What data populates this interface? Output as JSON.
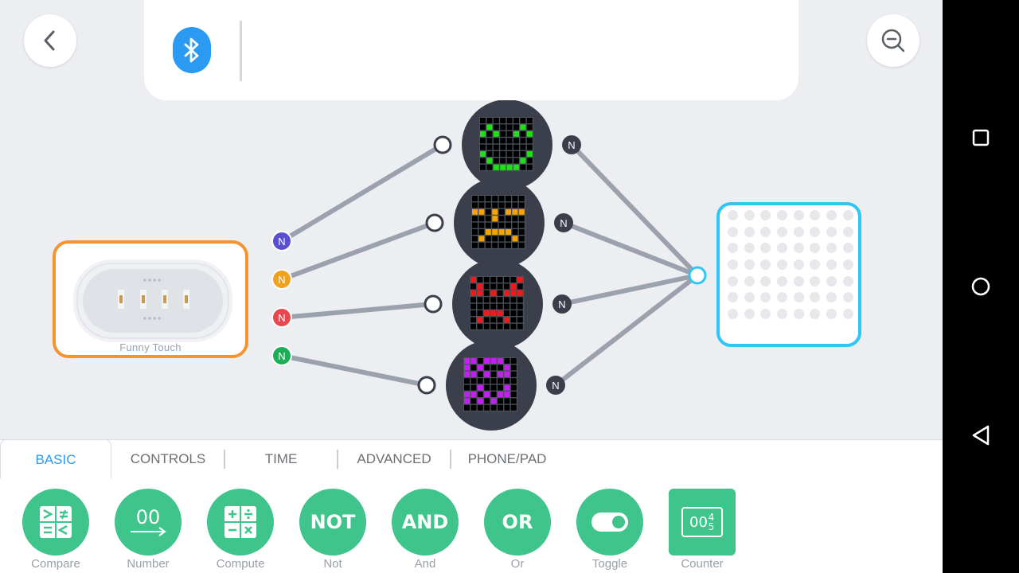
{
  "device": {
    "label": "Funny Touch"
  },
  "tabs": [
    {
      "label": "BASIC",
      "active": true
    },
    {
      "label": "CONTROLS",
      "active": false
    },
    {
      "label": "TIME",
      "active": false
    },
    {
      "label": "ADVANCED",
      "active": false
    },
    {
      "label": "PHONE/PAD",
      "active": false
    }
  ],
  "blocks": [
    {
      "label": "Compare",
      "icon": "compare-icon"
    },
    {
      "label": "Number",
      "icon": "number-icon",
      "glyph": "00"
    },
    {
      "label": "Compute",
      "icon": "compute-icon"
    },
    {
      "label": "Not",
      "icon": "not-icon",
      "glyph": "NOT"
    },
    {
      "label": "And",
      "icon": "and-icon",
      "glyph": "AND"
    },
    {
      "label": "Or",
      "icon": "or-icon",
      "glyph": "OR"
    },
    {
      "label": "Toggle",
      "icon": "toggle-icon"
    },
    {
      "label": "Counter",
      "icon": "counter-icon",
      "glyph": "00",
      "glyph_small": "45"
    }
  ],
  "node_badge": "N",
  "input_nodes": [
    {
      "color": "#5a4ed1",
      "label": "N"
    },
    {
      "color": "#f0a21f",
      "label": "N"
    },
    {
      "color": "#e9474e",
      "label": "N"
    },
    {
      "color": "#1fae58",
      "label": "N"
    }
  ],
  "output_nodes": [
    "N",
    "N",
    "N",
    "N"
  ],
  "faces": [
    {
      "name": "smile",
      "color": "#1ee014"
    },
    {
      "name": "neutral",
      "color": "#f5a400"
    },
    {
      "name": "angry",
      "color": "#f01a1a"
    },
    {
      "name": "confused",
      "color": "#c31ff2"
    }
  ],
  "colors": {
    "accent": "#2b9af3",
    "block_green": "#3fc48c",
    "device_border": "#f59331",
    "matrix_border": "#2fc6f3",
    "wire": "#9ba2ad",
    "face_bg": "#3a3f4b"
  }
}
